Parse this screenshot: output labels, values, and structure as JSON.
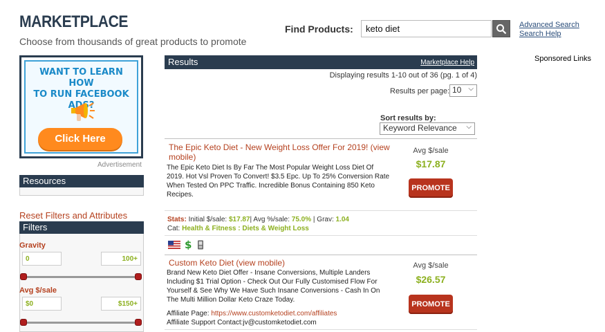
{
  "header": {
    "title": "MARKETPLACE",
    "subtitle": "Choose from thousands of great products to promote"
  },
  "search": {
    "label": "Find Products:",
    "value": "keto diet",
    "advanced_link": "Advanced Search",
    "help_link": "Search Help"
  },
  "ad": {
    "title_line1": "WANT TO LEARN HOW",
    "title_line2": "TO RUN FACEBOOK ADS?",
    "cta": "Click Here",
    "caption": "Advertisement"
  },
  "sidebar": {
    "resources_label": "Resources",
    "reset_label": "Reset Filters and Attributes",
    "filters_label": "Filters",
    "gravity": {
      "label": "Gravity",
      "min": "0",
      "max": "100+"
    },
    "avg_sale": {
      "label": "Avg $/sale",
      "min": "$0",
      "max": "$150+"
    }
  },
  "results": {
    "heading": "Results",
    "help_link": "Marketplace Help",
    "display_count": "Displaying results 1-10 out of 36 (pg. 1 of 4)",
    "per_page_label": "Results per page:",
    "per_page_value": "10",
    "sort_label": "Sort results by:",
    "sort_value": "Keyword Relevance"
  },
  "products": [
    {
      "title": "The Epic Keto Diet - New Weight Loss Offer For 2019! (view mobile)",
      "description": "The Epic Keto Diet Is By Far The Most Popular Weight Loss Diet Of 2019. Hot Vsl Proven To Convert! $3.5 Epc. Up To 25% Conversion Rate When Tested On PPC Traffic. Incredible Bonus Containing 850 Keto Recipes.",
      "avg_label": "Avg $/sale",
      "avg_value": "$17.87",
      "promote": "PROMOTE",
      "stats_label": "Stats:",
      "initial_label": "Initial $/sale:",
      "initial_value": "$17.87",
      "avg_pct_label": "| Avg %/sale:",
      "avg_pct_value": "75.0%",
      "grav_label": "| Grav:",
      "grav_value": "1.04",
      "cat_label": "Cat:",
      "cat_value": "Health & Fitness : Diets & Weight Loss"
    },
    {
      "title": "Custom Keto Diet (view mobile)",
      "description": "Brand New Keto Diet Offer - Insane Conversions, Multiple Landers Including $1 Trial Option - Check Out Our Fully Customised Flow For Yourself & See Why We Have Such Insane Conversions - Cash In On The Multi Million Dollar Keto Craze Today.",
      "avg_label": "Avg $/sale",
      "avg_value": "$26.57",
      "promote": "PROMOTE",
      "aff_page_label": "Affiliate Page:",
      "aff_page_url": "https://www.customketodiet.com/affiliates",
      "aff_support": "Affiliate Support Contact:jv@customketodiet.com"
    }
  ],
  "sponsored": "Sponsored Links",
  "icons": [
    "search-icon",
    "megaphone-icon",
    "us-flag-icon",
    "dollar-icon",
    "mobile-icon"
  ],
  "colors": {
    "navy": "#2a3c4f",
    "accent_red": "#b5411f",
    "green": "#8cb01f",
    "promote": "#b8341e",
    "ad_orange": "#ff8a1e"
  }
}
